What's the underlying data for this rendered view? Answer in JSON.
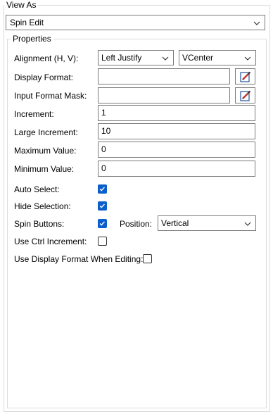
{
  "view_as": {
    "legend": "View As",
    "selected": "Spin Edit",
    "chevron_icon": "chevron-down-icon"
  },
  "properties": {
    "legend": "Properties",
    "alignment": {
      "label": "Alignment (H, V):",
      "horizontal": "Left Justify",
      "vertical": "VCenter"
    },
    "display_format": {
      "label": "Display Format:",
      "value": "",
      "button_icon": "pencil-edit-icon"
    },
    "input_format_mask": {
      "label": "Input Format Mask:",
      "value": "",
      "button_icon": "pencil-edit-icon"
    },
    "increment": {
      "label": "Increment:",
      "value": "1"
    },
    "large_increment": {
      "label": "Large Increment:",
      "value": "10"
    },
    "maximum_value": {
      "label": "Maximum Value:",
      "value": "0"
    },
    "minimum_value": {
      "label": "Minimum Value:",
      "value": "0"
    },
    "auto_select": {
      "label": "Auto Select:",
      "checked": true
    },
    "hide_selection": {
      "label": "Hide Selection:",
      "checked": true
    },
    "spin_buttons": {
      "label": "Spin Buttons:",
      "checked": true
    },
    "position": {
      "label": "Position:",
      "value": "Vertical"
    },
    "use_ctrl_increment": {
      "label": "Use Ctrl Increment:",
      "checked": false
    },
    "use_display_format_when_editing": {
      "label": "Use Display Format When Editing:",
      "checked": false
    }
  },
  "colors": {
    "checkbox_checked": "#0b5fcb",
    "border": "#7a7a7a",
    "group_border": "#dcdcdc"
  }
}
